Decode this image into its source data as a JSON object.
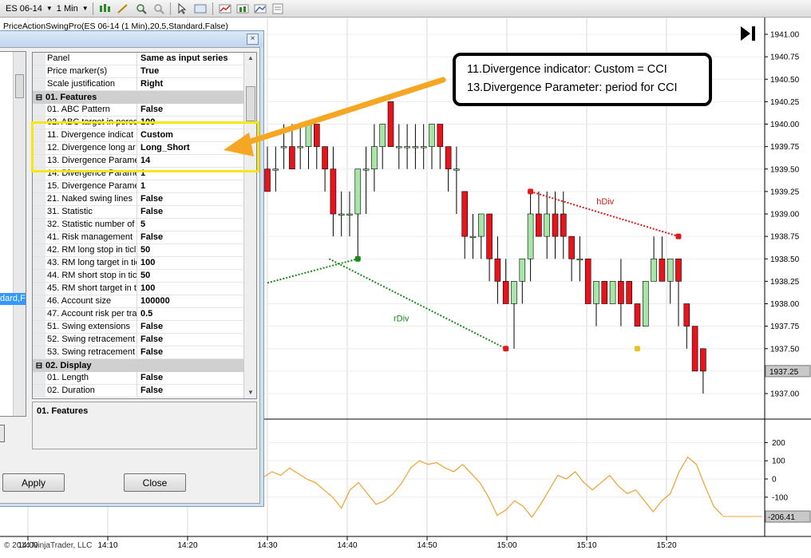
{
  "toolbar": {
    "instrument": "ES 06-14",
    "interval": "1 Min"
  },
  "indicator_label": "PriceActionSwingPro(ES 06-14 (1 Min),20,5,Standard,False)",
  "dialog": {
    "close_glyph": "×",
    "left_selected": "dard,Fa",
    "apply_label": "Apply",
    "close_label": "Close",
    "description_title": "01. Features",
    "rows": [
      {
        "kind": "prop",
        "name": "Panel",
        "value": "Same as input series"
      },
      {
        "kind": "prop",
        "name": "Price marker(s)",
        "value": "True"
      },
      {
        "kind": "prop",
        "name": "Scale justification",
        "value": "Right"
      },
      {
        "kind": "cat",
        "name": "01. Features"
      },
      {
        "kind": "prop",
        "name": "01. ABC Pattern",
        "value": "False"
      },
      {
        "kind": "prop",
        "name": "02. ABC target in perce",
        "value": "100"
      },
      {
        "kind": "prop",
        "name": "11. Divergence indicat",
        "value": "Custom"
      },
      {
        "kind": "prop",
        "name": "12. Divergence long ar",
        "value": "Long_Short"
      },
      {
        "kind": "prop",
        "name": "13. Divergence Parame",
        "value": "14"
      },
      {
        "kind": "prop",
        "name": "14. Divergence Parame",
        "value": "1"
      },
      {
        "kind": "prop",
        "name": "15. Divergence Parame",
        "value": "1"
      },
      {
        "kind": "prop",
        "name": "21. Naked swing lines",
        "value": "False"
      },
      {
        "kind": "prop",
        "name": "31. Statistic",
        "value": "False"
      },
      {
        "kind": "prop",
        "name": "32. Statistic number of",
        "value": "5"
      },
      {
        "kind": "prop",
        "name": "41. Risk management",
        "value": "False"
      },
      {
        "kind": "prop",
        "name": "42. RM long stop in ticl",
        "value": "50"
      },
      {
        "kind": "prop",
        "name": "43. RM long target in tic",
        "value": "100"
      },
      {
        "kind": "prop",
        "name": "44. RM short stop in tic",
        "value": "50"
      },
      {
        "kind": "prop",
        "name": "45. RM short target in t",
        "value": "100"
      },
      {
        "kind": "prop",
        "name": "46. Account size",
        "value": "100000"
      },
      {
        "kind": "prop",
        "name": "47. Account risk per tra",
        "value": "0.5"
      },
      {
        "kind": "prop",
        "name": "51. Swing extensions",
        "value": "False"
      },
      {
        "kind": "prop",
        "name": "52. Swing retracement",
        "value": "False"
      },
      {
        "kind": "prop",
        "name": "53. Swing retracement",
        "value": "False"
      },
      {
        "kind": "cat",
        "name": "02. Display"
      },
      {
        "kind": "prop",
        "name": "01. Length",
        "value": "False"
      },
      {
        "kind": "prop",
        "name": "02. Duration",
        "value": "False"
      }
    ]
  },
  "callout": {
    "line1": "11.Divergence indicator: Custom = CCI",
    "line2": "13.Divergence Parameter: period for CCI"
  },
  "copyright": "© 2014 NinjaTrader, LLC",
  "colors": {
    "up_bar": "#a8e6a8",
    "down_bar": "#e8141c",
    "cci_line": "#f0a030",
    "rdiv": "#1a8a1a",
    "hdiv": "#e01818",
    "highlight": "#f5e616",
    "arrow": "#f5a623"
  },
  "chart_data": {
    "type": "candlestick",
    "price_axis": {
      "ticks": [
        "1941.00",
        "1940.75",
        "1940.50",
        "1940.25",
        "1940.00",
        "1939.75",
        "1939.50",
        "1939.25",
        "1939.00",
        "1938.75",
        "1938.50",
        "1938.25",
        "1938.00",
        "1937.75",
        "1937.50",
        "1937.25",
        "1937.00"
      ],
      "last_price": "1937.25",
      "range": [
        1937.0,
        1941.0
      ]
    },
    "time_axis": {
      "ticks": [
        "14:00",
        "14:10",
        "14:20",
        "14:30",
        "14:40",
        "14:50",
        "15:00",
        "15:10",
        "15:20"
      ]
    },
    "oscillator_axis": {
      "ticks": [
        "200",
        "100",
        "0",
        "-100"
      ],
      "last_value": "-206.41",
      "range": [
        -250,
        250
      ]
    },
    "bars": [
      {
        "t": 0,
        "o": 1939.5,
        "h": 1939.75,
        "l": 1939.25,
        "c": 1939.25
      },
      {
        "t": 1,
        "o": 1939.5,
        "h": 1939.75,
        "l": 1939.25,
        "c": 1939.5
      },
      {
        "t": 2,
        "o": 1939.75,
        "h": 1940.0,
        "l": 1939.5,
        "c": 1939.75
      },
      {
        "t": 3,
        "o": 1939.75,
        "h": 1940.0,
        "l": 1939.5,
        "c": 1939.5
      },
      {
        "t": 4,
        "o": 1939.75,
        "h": 1940.0,
        "l": 1939.5,
        "c": 1939.75
      },
      {
        "t": 5,
        "o": 1939.75,
        "h": 1940.0,
        "l": 1939.5,
        "c": 1940.0
      },
      {
        "t": 6,
        "o": 1940.0,
        "h": 1940.0,
        "l": 1939.5,
        "c": 1939.75
      },
      {
        "t": 7,
        "o": 1939.75,
        "h": 1939.75,
        "l": 1939.25,
        "c": 1939.5
      },
      {
        "t": 8,
        "o": 1939.5,
        "h": 1939.75,
        "l": 1938.75,
        "c": 1939.0
      },
      {
        "t": 9,
        "o": 1939.0,
        "h": 1939.25,
        "l": 1938.75,
        "c": 1939.0
      },
      {
        "t": 10,
        "o": 1939.0,
        "h": 1939.25,
        "l": 1938.75,
        "c": 1939.0
      },
      {
        "t": 11,
        "o": 1939.0,
        "h": 1939.5,
        "l": 1938.5,
        "c": 1939.5
      },
      {
        "t": 12,
        "o": 1939.5,
        "h": 1939.75,
        "l": 1939.0,
        "c": 1939.5
      },
      {
        "t": 13,
        "o": 1939.5,
        "h": 1940.0,
        "l": 1939.25,
        "c": 1939.75
      },
      {
        "t": 14,
        "o": 1939.75,
        "h": 1940.0,
        "l": 1939.5,
        "c": 1940.0
      },
      {
        "t": 15,
        "o": 1940.25,
        "h": 1940.25,
        "l": 1939.75,
        "c": 1939.75
      },
      {
        "t": 16,
        "o": 1939.75,
        "h": 1940.0,
        "l": 1939.5,
        "c": 1939.75
      },
      {
        "t": 17,
        "o": 1939.75,
        "h": 1940.0,
        "l": 1939.5,
        "c": 1939.75
      },
      {
        "t": 18,
        "o": 1939.75,
        "h": 1940.0,
        "l": 1939.5,
        "c": 1939.75
      },
      {
        "t": 19,
        "o": 1939.75,
        "h": 1940.0,
        "l": 1939.5,
        "c": 1939.75
      },
      {
        "t": 20,
        "o": 1939.75,
        "h": 1940.0,
        "l": 1939.5,
        "c": 1940.0
      },
      {
        "t": 21,
        "o": 1940.0,
        "h": 1940.0,
        "l": 1939.5,
        "c": 1939.75
      },
      {
        "t": 22,
        "o": 1939.75,
        "h": 1939.75,
        "l": 1939.25,
        "c": 1939.5
      },
      {
        "t": 23,
        "o": 1939.5,
        "h": 1939.75,
        "l": 1939.0,
        "c": 1939.5
      },
      {
        "t": 24,
        "o": 1939.25,
        "h": 1939.25,
        "l": 1938.5,
        "c": 1938.75
      },
      {
        "t": 25,
        "o": 1938.75,
        "h": 1939.0,
        "l": 1938.5,
        "c": 1938.75
      },
      {
        "t": 26,
        "o": 1938.75,
        "h": 1939.0,
        "l": 1938.5,
        "c": 1939.0
      },
      {
        "t": 27,
        "o": 1939.0,
        "h": 1939.0,
        "l": 1938.25,
        "c": 1938.5
      },
      {
        "t": 28,
        "o": 1938.5,
        "h": 1938.75,
        "l": 1938.0,
        "c": 1938.25
      },
      {
        "t": 29,
        "o": 1938.25,
        "h": 1938.5,
        "l": 1938.0,
        "c": 1938.0
      },
      {
        "t": 30,
        "o": 1938.0,
        "h": 1938.25,
        "l": 1937.5,
        "c": 1938.25
      },
      {
        "t": 31,
        "o": 1938.25,
        "h": 1938.5,
        "l": 1938.0,
        "c": 1938.5
      },
      {
        "t": 32,
        "o": 1938.5,
        "h": 1939.25,
        "l": 1938.25,
        "c": 1939.0
      },
      {
        "t": 33,
        "o": 1939.0,
        "h": 1939.25,
        "l": 1938.75,
        "c": 1938.75
      },
      {
        "t": 34,
        "o": 1938.75,
        "h": 1939.25,
        "l": 1938.5,
        "c": 1939.0
      },
      {
        "t": 35,
        "o": 1939.0,
        "h": 1939.25,
        "l": 1938.5,
        "c": 1938.75
      },
      {
        "t": 36,
        "o": 1939.0,
        "h": 1939.25,
        "l": 1938.5,
        "c": 1938.75
      },
      {
        "t": 37,
        "o": 1938.75,
        "h": 1938.75,
        "l": 1938.25,
        "c": 1938.5
      },
      {
        "t": 38,
        "o": 1938.5,
        "h": 1938.75,
        "l": 1938.25,
        "c": 1938.5
      },
      {
        "t": 39,
        "o": 1938.5,
        "h": 1938.5,
        "l": 1938.0,
        "c": 1938.0
      },
      {
        "t": 40,
        "o": 1938.0,
        "h": 1938.25,
        "l": 1937.75,
        "c": 1938.25
      },
      {
        "t": 41,
        "o": 1938.25,
        "h": 1938.25,
        "l": 1938.0,
        "c": 1938.0
      },
      {
        "t": 42,
        "o": 1938.0,
        "h": 1938.25,
        "l": 1938.0,
        "c": 1938.25
      },
      {
        "t": 43,
        "o": 1938.25,
        "h": 1938.5,
        "l": 1937.75,
        "c": 1938.0
      },
      {
        "t": 44,
        "o": 1938.25,
        "h": 1938.25,
        "l": 1938.0,
        "c": 1938.0
      },
      {
        "t": 45,
        "o": 1938.0,
        "h": 1938.0,
        "l": 1937.75,
        "c": 1937.75
      },
      {
        "t": 46,
        "o": 1937.75,
        "h": 1938.25,
        "l": 1937.75,
        "c": 1938.25
      },
      {
        "t": 47,
        "o": 1938.25,
        "h": 1938.75,
        "l": 1938.25,
        "c": 1938.5
      },
      {
        "t": 48,
        "o": 1938.5,
        "h": 1938.75,
        "l": 1938.25,
        "c": 1938.25
      },
      {
        "t": 49,
        "o": 1938.25,
        "h": 1938.5,
        "l": 1938.0,
        "c": 1938.5
      },
      {
        "t": 50,
        "o": 1938.5,
        "h": 1938.5,
        "l": 1937.75,
        "c": 1938.25
      },
      {
        "t": 51,
        "o": 1938.0,
        "h": 1938.0,
        "l": 1937.5,
        "c": 1937.75
      },
      {
        "t": 52,
        "o": 1937.75,
        "h": 1937.75,
        "l": 1937.25,
        "c": 1937.25
      },
      {
        "t": 53,
        "o": 1937.5,
        "h": 1937.5,
        "l": 1937.0,
        "c": 1937.25
      }
    ],
    "divergences": [
      {
        "label": "rDiv",
        "color": "#1a8a1a",
        "points": [
          [
            7.5,
            1938.5
          ],
          [
            29.0,
            1937.5
          ]
        ]
      },
      {
        "label": "hDiv",
        "color": "#e01818",
        "points": [
          [
            32.0,
            1939.25
          ],
          [
            50.0,
            1938.75
          ]
        ]
      }
    ],
    "markers": [
      {
        "t": 11.0,
        "price": 1938.5,
        "color": "#1a8a1a"
      },
      {
        "t": 29.0,
        "price": 1937.5,
        "color": "#e01818"
      },
      {
        "t": 32.0,
        "price": 1939.25,
        "color": "#e01818"
      },
      {
        "t": 50.0,
        "price": 1938.75,
        "color": "#e01818"
      },
      {
        "t": 45.0,
        "price": 1937.5,
        "color": "#f0c020"
      }
    ],
    "cci": [
      10,
      40,
      20,
      60,
      30,
      0,
      -20,
      -60,
      -100,
      -160,
      -60,
      -20,
      -80,
      -140,
      -120,
      -80,
      -20,
      60,
      100,
      80,
      90,
      60,
      40,
      80,
      30,
      -20,
      -100,
      -200,
      -170,
      -120,
      -150,
      -210,
      -140,
      -60,
      20,
      0,
      40,
      -20,
      -60,
      -20,
      20,
      -40,
      -80,
      -60,
      -120,
      -180,
      -120,
      -80,
      40,
      120,
      80,
      -40,
      -150,
      -200
    ],
    "xlabel": "",
    "ylabel": ""
  }
}
